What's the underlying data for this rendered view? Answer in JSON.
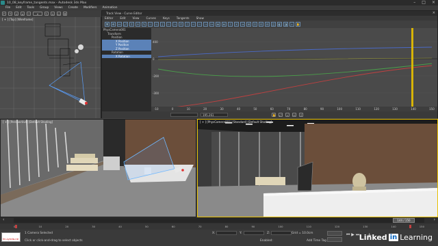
{
  "window": {
    "title": "10_08_keyframe_tangents.max - Autodesk 3ds Max"
  },
  "menubar": [
    "File",
    "Edit",
    "Tools",
    "Group",
    "Views",
    "Create",
    "Modifiers",
    "Animation"
  ],
  "toolbar": {
    "icons": [
      "undo-icon",
      "redo-icon",
      "link-icon",
      "unlink-icon",
      "bind-icon",
      "select-filter-icon",
      "select-icon",
      "select-by-name-icon",
      "region-icon",
      "move-icon"
    ]
  },
  "curve_editor": {
    "title": "Track View - Curve Editor",
    "menu": [
      "Editor",
      "Edit",
      "View",
      "Curves",
      "Keys",
      "Tangents",
      "Show"
    ],
    "tree": [
      {
        "label": "PhysCamera001",
        "selected": false
      },
      {
        "label": "Transform",
        "selected": false
      },
      {
        "label": "Position",
        "selected": false
      },
      {
        "label": "X Position",
        "selected": true
      },
      {
        "label": "Y Position",
        "selected": true
      },
      {
        "label": "Z Position",
        "selected": true
      },
      {
        "label": "Rotation",
        "selected": false
      },
      {
        "label": "X Rotation",
        "selected": true
      }
    ],
    "graph": {
      "y_ticks": [
        "400",
        "0",
        "-200",
        "-300"
      ],
      "x_ticks": [
        "-10",
        "0",
        "10",
        "20",
        "30",
        "40",
        "50",
        "60",
        "70",
        "80",
        "90",
        "100",
        "110",
        "120",
        "130",
        "140",
        "150"
      ],
      "current_frame_marker": 144
    },
    "status_box_value": "195.261"
  },
  "viewports": {
    "top_left_label": "[ + ] [Top] [Wireframe]",
    "bottom_left_label": "[ + ] [Perspective] [Default Shading]",
    "bottom_right_label": "[ + ] [PhysCamera001] [Standard] [Default Shading]"
  },
  "timeline": {
    "frame_display": "144 / 150",
    "ticks": [
      "0",
      "10",
      "20",
      "30",
      "40",
      "50",
      "60",
      "70",
      "80",
      "90",
      "100",
      "110",
      "120",
      "130",
      "140",
      "150"
    ]
  },
  "status": {
    "selected": "1 Camera Selected",
    "prompt": "Click or click-and-drag to select objects",
    "enabled": "Enabled:",
    "grid": "Grid = 10.0cm",
    "add_time_tag": "Add Time Tag",
    "script_prompt": "lin-Lynda-ne",
    "coords": {
      "x": "X:",
      "y": "Y:",
      "z": "Z:"
    }
  },
  "brand": {
    "word1": "Linked",
    "in": "in",
    "word2": "Learning"
  },
  "colors": {
    "accent_yellow": "#e8c000",
    "selection_blue": "#5b82b8",
    "curve_red": "#c24040",
    "curve_green": "#4aa04a",
    "curve_blue": "#4a6ac8"
  }
}
